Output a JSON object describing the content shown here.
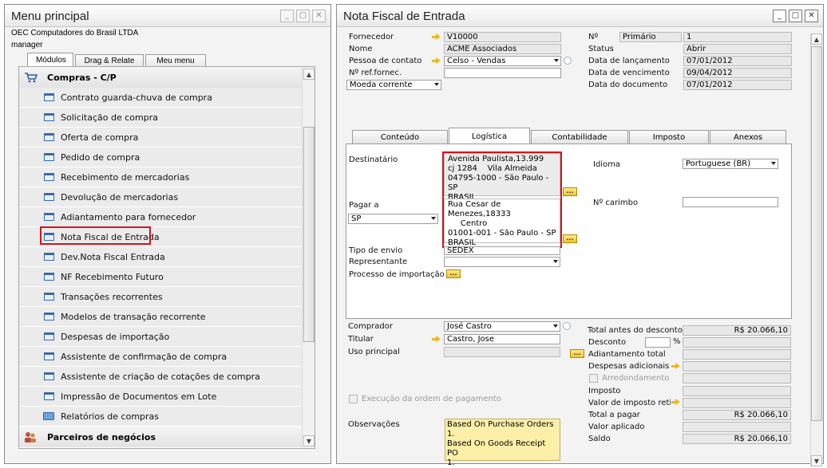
{
  "left_window": {
    "title": "Menu principal",
    "company": "OEC Computadores do Brasil LTDA",
    "user": "manager",
    "tabs": [
      "Módulos",
      "Drag & Relate",
      "Meu menu"
    ],
    "section_title": "Compras - C/P",
    "items": [
      "Contrato guarda-chuva de compra",
      "Solicitação de compra",
      "Oferta de compra",
      "Pedido de compra",
      "Recebimento de mercadorias",
      "Devolução de mercadorias",
      "Adiantamento para fornecedor",
      "Nota Fiscal de Entrada",
      "Dev.Nota Fiscal Entrada",
      "NF Recebimento Futuro",
      "Transações recorrentes",
      "Modelos de transação recorrente",
      "Despesas de importação",
      "Assistente de confirmação de compra",
      "Assistente de criação de cotações de compra",
      "Impressão de Documentos em Lote",
      "Relatórios de compras"
    ],
    "next_section": "Parceiros de negócios",
    "highlighted_item": "Nota Fiscal de Entrada"
  },
  "right_window": {
    "title": "Nota Fiscal de Entrada",
    "header": {
      "fornecedor_label": "Fornecedor",
      "fornecedor_value": "V10000",
      "nome_label": "Nome",
      "nome_value": "ACME Associados",
      "contato_label": "Pessoa de contato",
      "contato_value": "Celso - Vendas",
      "ref_label": "Nº ref.fornec.",
      "ref_value": "",
      "moeda_value": "Moeda corrente",
      "no_label": "Nº",
      "serie_value": "Primário",
      "no_value": "1",
      "status_label": "Status",
      "status_value": "Abrir",
      "lancamento_label": "Data de lançamento",
      "lancamento_value": "07/01/2012",
      "vencimento_label": "Data de vencimento",
      "vencimento_value": "09/04/2012",
      "documento_label": "Data do documento",
      "documento_value": "07/01/2012"
    },
    "tabs": [
      "Conteúdo",
      "Logística",
      "Contabilidade",
      "Imposto",
      "Anexos"
    ],
    "logistica": {
      "destinatario_label": "Destinatário",
      "destinatario_lines": [
        "Avenida Paulista,13.999",
        "cj 1284    Vila Almeida",
        "04795-1000 - São Paulo - SP",
        "BRASIL"
      ],
      "pagar_label": "Pagar a",
      "pagar_value": "SP",
      "pagar_lines": [
        "Rua Cesar de Menezes,18333",
        "     Centro",
        "01001-001 - São Paulo - SP",
        "BRASIL"
      ],
      "envio_label": "Tipo de envio",
      "envio_value": "SEDEX",
      "representante_label": "Representante",
      "processo_label": "Processo de importação",
      "idioma_label": "Idioma",
      "idioma_value": "Portuguese (BR)",
      "carimbo_label": "Nº carimbo",
      "carimbo_value": ""
    },
    "footer": {
      "comprador_label": "Comprador",
      "comprador_value": "José Castro",
      "titular_label": "Titular",
      "titular_value": "Castro, Jose",
      "uso_label": "Uso principal",
      "execucao_label": "Execução da ordem de pagamento",
      "obs_label": "Observações",
      "obs_lines": [
        "Based On Purchase Orders 1.",
        "Based On Goods Receipt PO",
        "1."
      ],
      "totals": [
        {
          "label": "Total antes do desconto",
          "value": "R$ 20.066,10"
        },
        {
          "label": "Desconto",
          "value": ""
        },
        {
          "label": "Adiantamento total",
          "value": ""
        },
        {
          "label": "Despesas adicionais",
          "value": ""
        },
        {
          "label": "Arredondamento",
          "value": ""
        },
        {
          "label": "Imposto",
          "value": ""
        },
        {
          "label": "Valor de imposto retidc",
          "value": ""
        },
        {
          "label": "Total a pagar",
          "value": "R$ 20.066,10"
        },
        {
          "label": "Valor aplicado",
          "value": ""
        },
        {
          "label": "Saldo",
          "value": "R$ 20.066,10"
        }
      ],
      "percent_sign": "%"
    }
  },
  "colors": {
    "highlight": "#d0161b",
    "memo": "#fcefa8",
    "arrow": "#f0b81b"
  }
}
